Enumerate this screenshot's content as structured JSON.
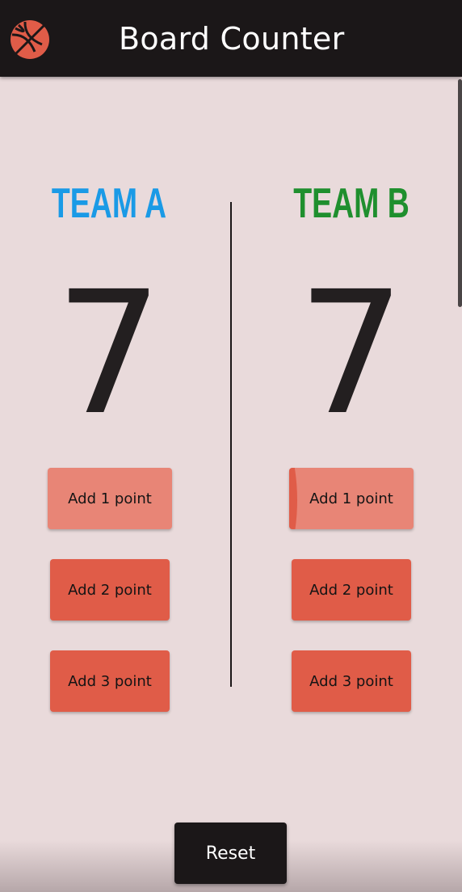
{
  "app_bar": {
    "title": "Board Counter",
    "icon": "basketball-icon",
    "icon_color": "#e05c48",
    "background": "#1b1718"
  },
  "team_a": {
    "name": "TEAM A",
    "name_color": "#1a9ae6",
    "score": "7",
    "buttons": [
      "Add  1 point",
      "Add 2 point",
      "Add 3 point"
    ]
  },
  "team_b": {
    "name": "TEAM B",
    "name_color": "#1f8f2e",
    "score": "7",
    "buttons": [
      "Add  1 point",
      "Add 2 point",
      "Add 3 point"
    ]
  },
  "reset": {
    "label": "Reset"
  },
  "colors": {
    "background": "#e9dadb",
    "button": "#e05c48",
    "button_light": "#e88576",
    "text_dark": "#231f20"
  }
}
